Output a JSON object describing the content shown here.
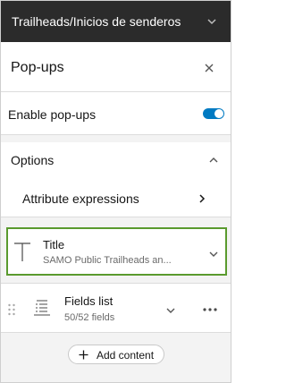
{
  "layer_header": {
    "title": "Trailheads/Inicios de senderos",
    "icon": "chevron-down-icon"
  },
  "panel": {
    "title": "Pop-ups",
    "close_icon": "close-icon"
  },
  "enable_popups": {
    "label": "Enable pop-ups",
    "enabled": true,
    "accent_color": "#007ac2"
  },
  "options": {
    "label": "Options",
    "expanded": true,
    "attribute_expressions": {
      "label": "Attribute expressions"
    }
  },
  "content_blocks": {
    "title": {
      "name": "Title",
      "description": "SAMO Public Trailheads an...",
      "selected": true,
      "highlight_color": "#5a9a2e"
    },
    "fields_list": {
      "name": "Fields list",
      "count": "50/52 fields"
    }
  },
  "add_content": {
    "label": "Add content"
  }
}
